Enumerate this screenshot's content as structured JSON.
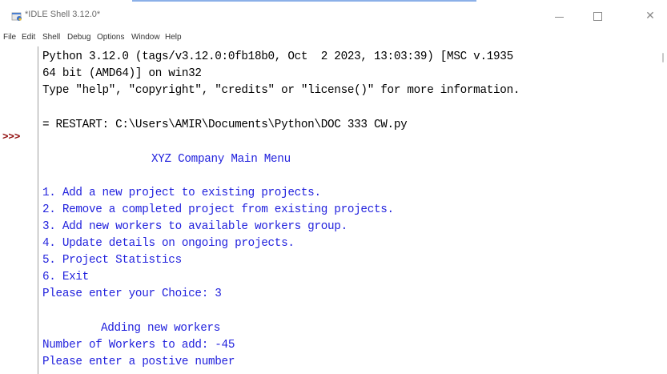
{
  "window": {
    "title": "*IDLE Shell 3.12.0*",
    "app_icon": "idle-python-icon",
    "controls": {
      "minimize": "minimize-icon",
      "maximize": "maximize-icon",
      "close": "close-icon",
      "close_glyph": "✕"
    }
  },
  "menubar": {
    "items": [
      "File",
      "Edit",
      "Shell",
      "Debug",
      "Options",
      "Window",
      "Help"
    ]
  },
  "gutter": {
    "prompt": ">>>"
  },
  "shell": {
    "banner_line1": "Python 3.12.0 (tags/v3.12.0:0fb18b0, Oct  2 2023, 13:03:39) [MSC v.1935",
    "banner_line2": "64 bit (AMD64)] on win32",
    "banner_line3": "Type \"help\", \"copyright\", \"credits\" or \"license()\" for more information.",
    "restart_line": "= RESTART: C:\\Users\\AMIR\\Documents\\Python\\DOC 333 CW.py",
    "menu_title": "XYZ Company Main Menu",
    "options": [
      "1. Add a new project to existing projects.",
      "2. Remove a completed project from existing projects.",
      "3. Add new workers to available workers group.",
      "4. Update details on ongoing projects.",
      "5. Project Statistics",
      "6. Exit"
    ],
    "choice_prompt": "Please enter your Choice: 3",
    "section_title": "Adding new workers",
    "workers_prompt": "Number of Workers to add: -45",
    "error_message": "Please enter a postive number"
  },
  "colors": {
    "stdout_text": "#2222dd",
    "stdin_text": "#000000",
    "prompt": "#8b0000"
  }
}
